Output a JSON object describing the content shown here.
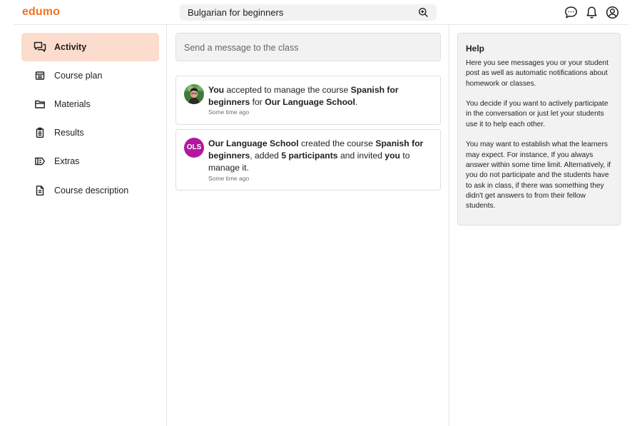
{
  "header": {
    "logo": "edumo",
    "search_value": "Bulgarian for beginners",
    "icons": [
      "chat-icon",
      "bell-icon",
      "user-account-icon"
    ]
  },
  "sidebar": {
    "items": [
      {
        "label": "Activity",
        "icon": "chat-bubbles-icon",
        "active": true
      },
      {
        "label": "Course plan",
        "icon": "calendar-icon",
        "active": false
      },
      {
        "label": "Materials",
        "icon": "folder-icon",
        "active": false
      },
      {
        "label": "Results",
        "icon": "clipboard-icon",
        "active": false
      },
      {
        "label": "Extras",
        "icon": "ticket-icon",
        "active": false
      },
      {
        "label": "Course description",
        "icon": "document-icon",
        "active": false
      }
    ]
  },
  "main": {
    "compose_placeholder": "Send a message to the class",
    "activities": [
      {
        "avatar": "user-photo",
        "segments": [
          {
            "text": "You",
            "bold": true
          },
          {
            "text": " accepted to manage the course ",
            "bold": false
          },
          {
            "text": "Spanish for beginners",
            "bold": true
          },
          {
            "text": " for ",
            "bold": false
          },
          {
            "text": "Our Language School",
            "bold": true
          },
          {
            "text": ".",
            "bold": false
          }
        ],
        "time": "Some time ago"
      },
      {
        "avatar": "OLS",
        "segments": [
          {
            "text": "Our Language School",
            "bold": true
          },
          {
            "text": " created the course ",
            "bold": false
          },
          {
            "text": "Spanish for beginners",
            "bold": true
          },
          {
            "text": ", added ",
            "bold": false
          },
          {
            "text": "5 participants",
            "bold": true
          },
          {
            "text": " and invited ",
            "bold": false
          },
          {
            "text": "you",
            "bold": true
          },
          {
            "text": " to manage it.",
            "bold": false
          }
        ],
        "time": "Some time ago"
      }
    ]
  },
  "help": {
    "title": "Help",
    "paragraphs": [
      "Here you see messages you or your student post as well as automatic notifications about homework or classes.",
      "You decide if you want to actively participate in the conversation or just let your students use it to help each other.",
      "You may want to establish what the learners may expect. For instance, If you always answer within some time limit. Alternatively, if you do not participate and the students have to ask in class, if there was something they didn't get answers to from their fellow students."
    ]
  },
  "colors": {
    "brand": "#f27121",
    "active_nav_bg": "#fcdccd",
    "ols_avatar": "#b3179e"
  }
}
